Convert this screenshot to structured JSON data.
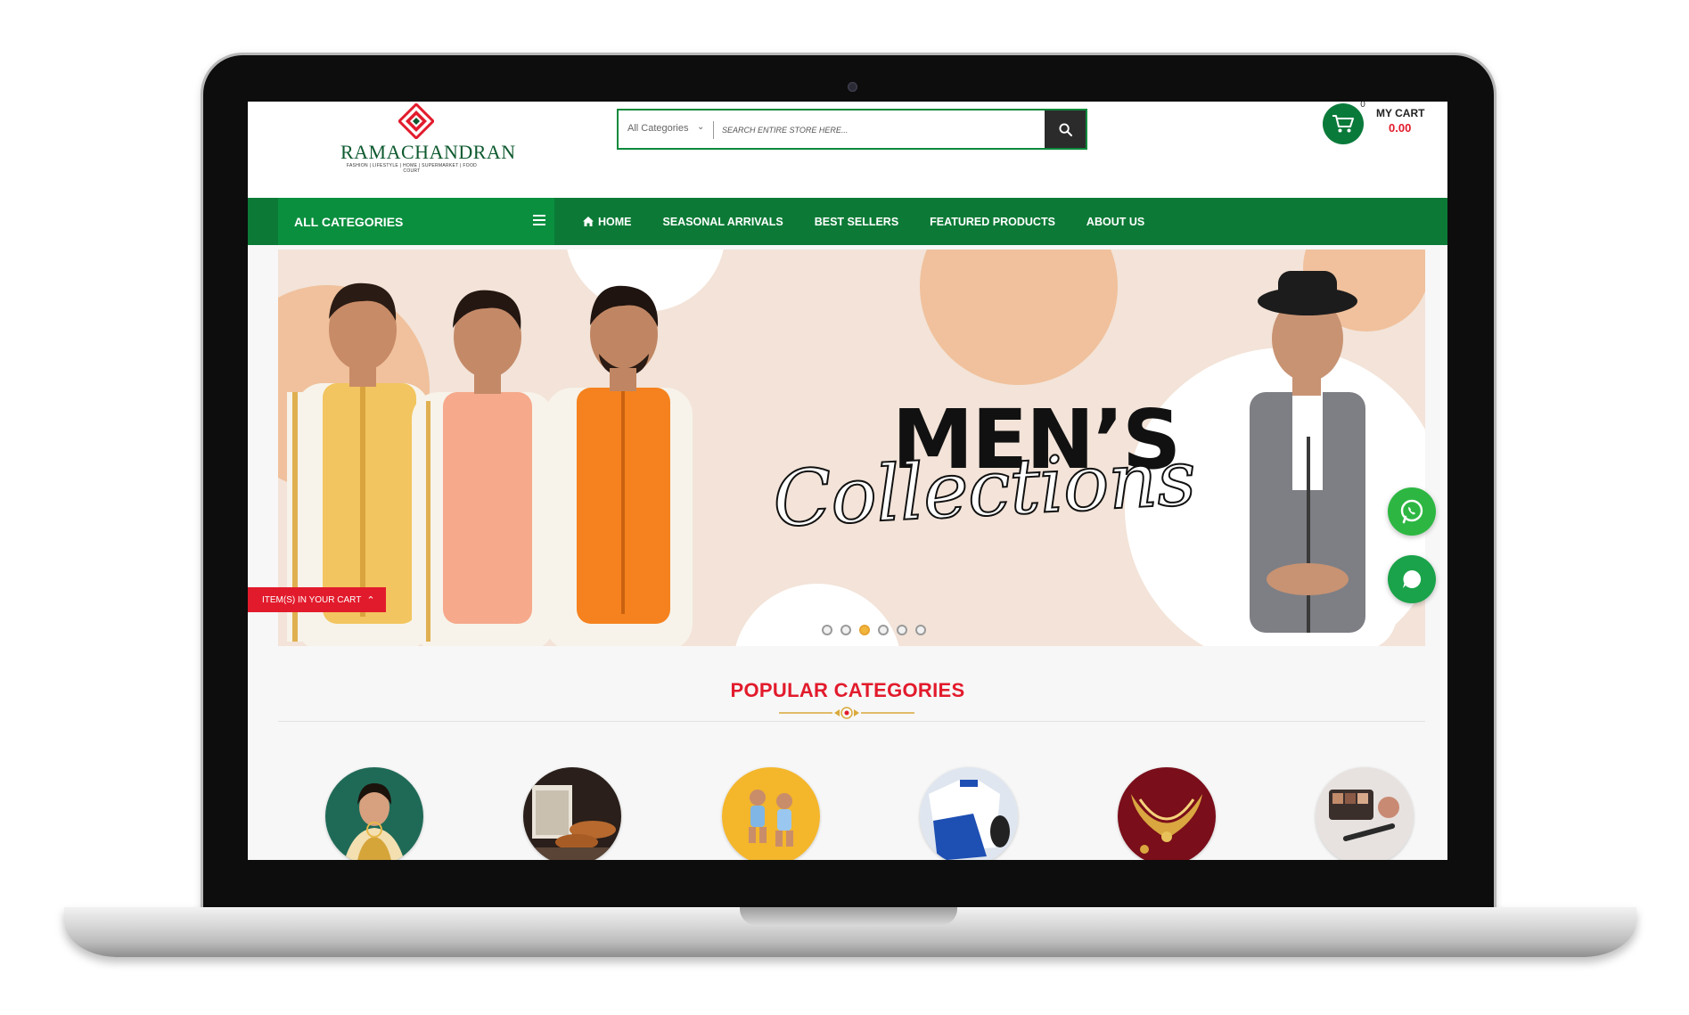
{
  "brand": {
    "name": "RAMACHANDRAN",
    "tagline": "FASHION | LIFESTYLE | HOME | SUPERMARKET | FOOD COURT",
    "primary_color": "#0c7a36",
    "accent_color": "#e21b2c"
  },
  "search": {
    "category_label": "All Categories",
    "placeholder": "SEARCH ENTIRE STORE HERE...",
    "button_icon": "search-icon"
  },
  "cart": {
    "icon": "cart-icon",
    "count": "0",
    "label": "MY CART",
    "amount": "0.00"
  },
  "nav": {
    "all_categories": "ALL CATEGORIES",
    "links": [
      "HOME",
      "SEASONAL ARRIVALS",
      "BEST SELLERS",
      "FEATURED PRODUCTS",
      "ABOUT US"
    ]
  },
  "banner": {
    "headline": "MEN’S",
    "script": "Collections",
    "slides_total": 6,
    "active_slide": 3
  },
  "cart_ribbon": {
    "label": "ITEM(S) IN YOUR CART"
  },
  "floating": {
    "whatsapp_icon": "whatsapp-icon",
    "chat_icon": "chat-icon"
  },
  "popular": {
    "title": "POPULAR CATEGORIES",
    "items": [
      {
        "icon": "saree-category-image"
      },
      {
        "icon": "footwear-category-image"
      },
      {
        "icon": "kids-category-image"
      },
      {
        "icon": "sportswear-category-image"
      },
      {
        "icon": "jewellery-category-image"
      },
      {
        "icon": "cosmetics-category-image"
      }
    ]
  }
}
